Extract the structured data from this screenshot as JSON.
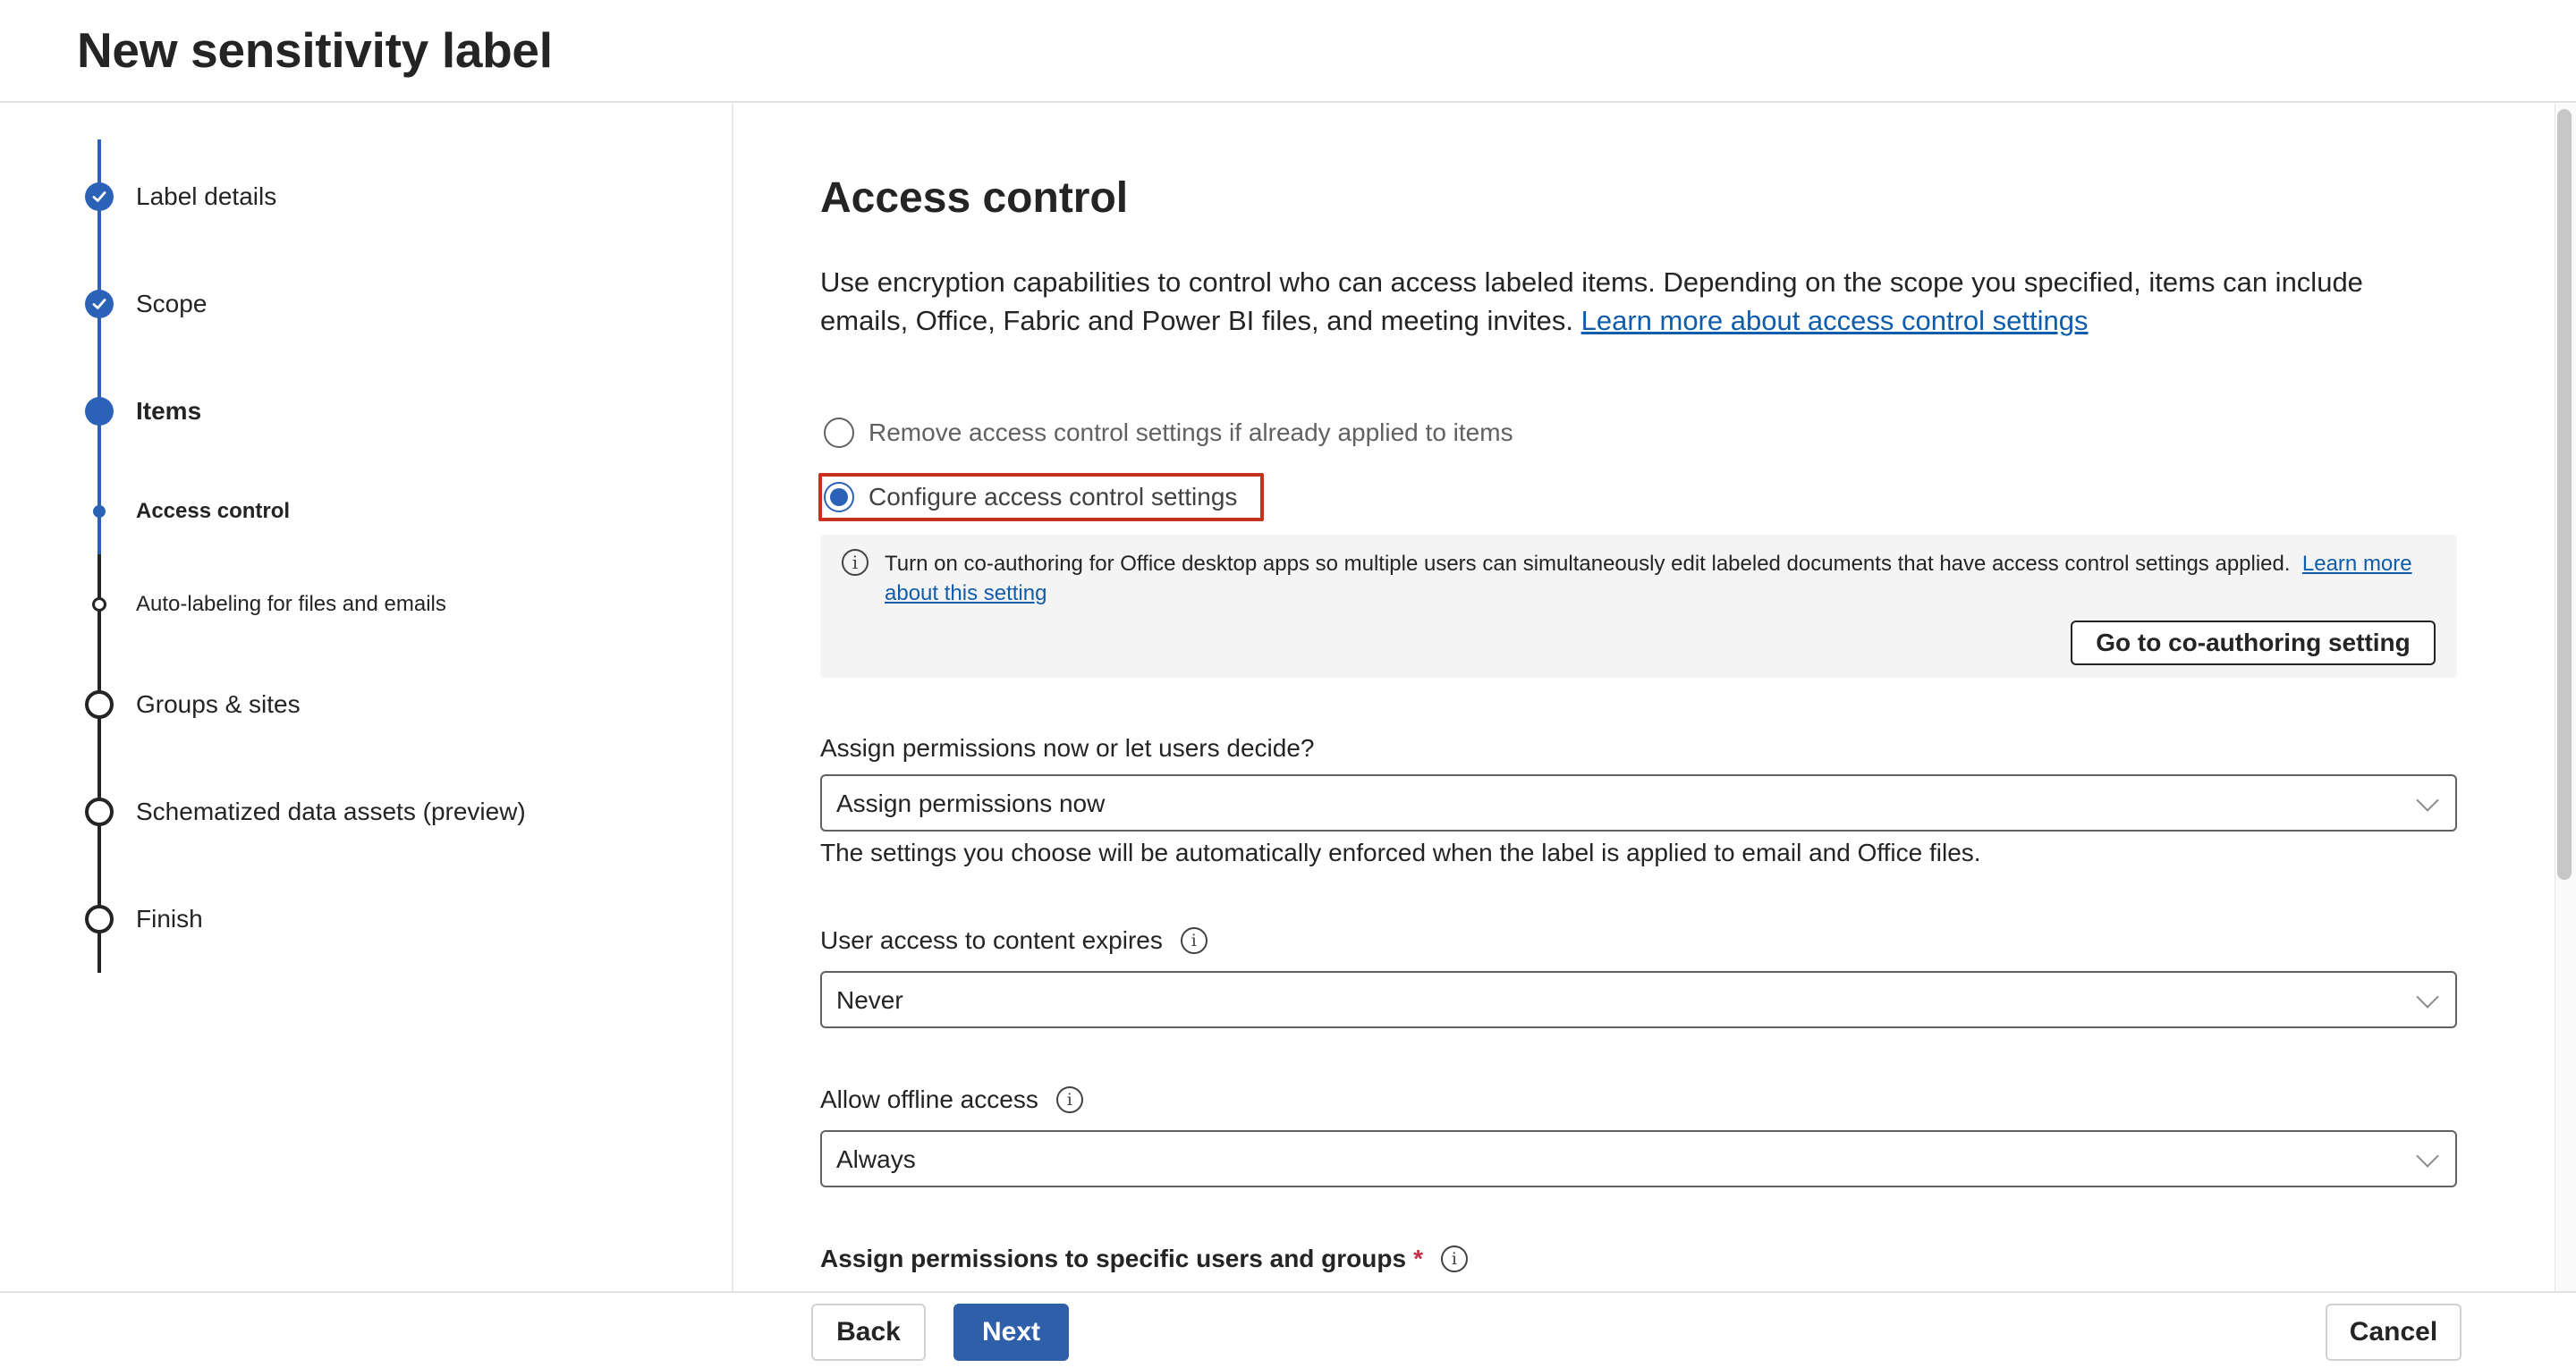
{
  "header": {
    "title": "New sensitivity label"
  },
  "nav": {
    "steps": [
      {
        "label": "Label details"
      },
      {
        "label": "Scope"
      },
      {
        "label": "Items"
      },
      {
        "label": "Access control"
      },
      {
        "label": "Auto-labeling for files and emails"
      },
      {
        "label": "Groups & sites"
      },
      {
        "label": "Schematized data assets (preview)"
      },
      {
        "label": "Finish"
      }
    ]
  },
  "main": {
    "title": "Access control",
    "description": "Use encryption capabilities to control who can access labeled items. Depending on the scope you specified, items can include emails, Office, Fabric and Power BI files, and meeting invites.",
    "learn_more_link": "Learn more about access control settings",
    "options": {
      "remove": "Remove access control settings if already applied to items",
      "configure": "Configure access control settings",
      "selected": "configure"
    },
    "info": {
      "text": "Turn on co-authoring for Office desktop apps so multiple users can simultaneously edit labeled documents that have access control settings applied.",
      "link": "Learn more about this setting",
      "button": "Go to co-authoring setting"
    },
    "assign_permissions": {
      "label": "Assign permissions now or let users decide?",
      "value": "Assign permissions now",
      "help": "The settings you choose will be automatically enforced when the label is applied to email and Office files."
    },
    "expires": {
      "label": "User access to content expires",
      "value": "Never"
    },
    "offline": {
      "label": "Allow offline access",
      "value": "Always"
    },
    "specific_users": {
      "label": "Assign permissions to specific users and groups",
      "required_mark": "*"
    }
  },
  "footer": {
    "back": "Back",
    "next": "Next",
    "cancel": "Cancel"
  },
  "colors": {
    "accent": "#2b62b8",
    "link": "#0f5cab",
    "highlight": "#c8301e"
  }
}
